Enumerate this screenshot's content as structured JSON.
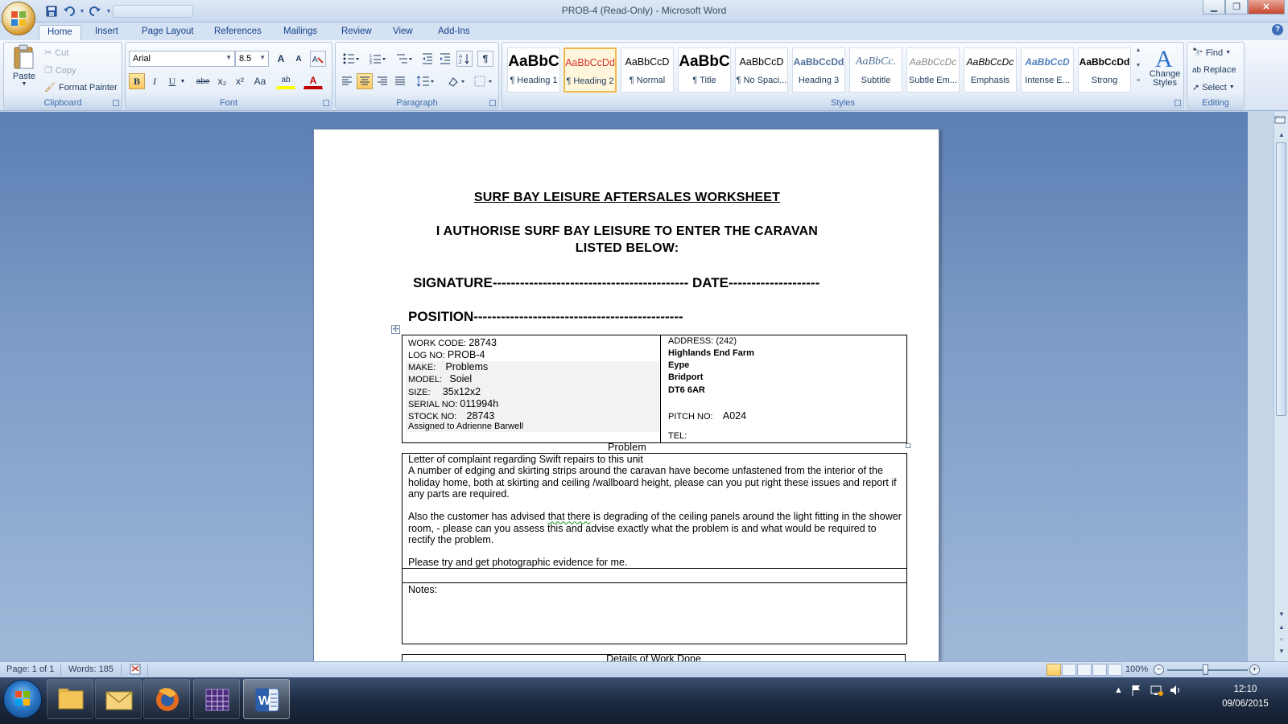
{
  "window": {
    "title": "PROB-4 (Read-Only) - Microsoft Word",
    "min": "▁",
    "max": "❐",
    "close": "✕"
  },
  "tabs": [
    {
      "label": "Home"
    },
    {
      "label": "Insert"
    },
    {
      "label": "Page Layout"
    },
    {
      "label": "References"
    },
    {
      "label": "Mailings"
    },
    {
      "label": "Review"
    },
    {
      "label": "View"
    },
    {
      "label": "Add-Ins"
    }
  ],
  "clipboard": {
    "paste": "Paste",
    "cut": "Cut",
    "copy": "Copy",
    "format_painter": "Format Painter",
    "label": "Clipboard"
  },
  "font": {
    "family": "Arial",
    "size": "8.5",
    "label": "Font",
    "bold": "B",
    "italic": "I",
    "underline": "U",
    "strike": "abe",
    "sub": "x₂",
    "sup": "x²",
    "case": "Aa",
    "grow": "A",
    "shrink": "A",
    "highlight": "ab",
    "color": "A"
  },
  "paragraph": {
    "label": "Paragraph",
    "pilcrow": "¶"
  },
  "styles": {
    "label": "Styles",
    "items": [
      {
        "sample": "AaBbC",
        "name": "¶ Heading 1"
      },
      {
        "sample": "AaBbCcDd",
        "name": "¶ Heading 2"
      },
      {
        "sample": "AaBbCcD",
        "name": "¶ Normal"
      },
      {
        "sample": "AaBbC",
        "name": "¶ Title"
      },
      {
        "sample": "AaBbCcD",
        "name": "¶ No Spaci..."
      },
      {
        "sample": "AaBbCcDd",
        "name": "Heading 3"
      },
      {
        "sample": "AaBbCc.",
        "name": "Subtitle"
      },
      {
        "sample": "AaBbCcDc",
        "name": "Subtle Em..."
      },
      {
        "sample": "AaBbCcDc",
        "name": "Emphasis"
      },
      {
        "sample": "AaBbCcD",
        "name": "Intense E..."
      },
      {
        "sample": "AaBbCcDd",
        "name": "Strong"
      }
    ],
    "change_styles": "Change Styles"
  },
  "editing": {
    "label": "Editing",
    "find": "Find",
    "replace": "Replace",
    "select": "Select"
  },
  "doc": {
    "title": "SURF BAY LEISURE AFTERSALES WORKSHEET",
    "auth1": "I AUTHORISE SURF BAY LEISURE TO ENTER THE CARAVAN",
    "auth2": "LISTED BELOW:",
    "signature": "SIGNATURE------------------------------------------- DATE--------------------",
    "position": "POSITION----------------------------------------------",
    "work_code_label": "WORK CODE:",
    "work_code": "28743",
    "log_no_label": "LOG NO:",
    "log_no": "PROB-4",
    "make_label": "MAKE:",
    "make": "Problems",
    "model_label": "MODEL:",
    "model": "Soiel",
    "size_label": "SIZE:",
    "size": "35x12x2",
    "serial_label": "SERIAL NO:",
    "serial": "011994h",
    "stock_label": "STOCK NO:",
    "stock": "28743",
    "assigned": "Assigned to Adrienne Barwell",
    "address_label": "ADDRESS:",
    "address_num": "(242)",
    "addr1": "Highlands End Farm",
    "addr2": "Eype",
    "addr3": "Bridport",
    "addr4": "DT6 6AR",
    "pitch_label": "PITCH NO:",
    "pitch": "A024",
    "tel_label": "TEL:",
    "problem_header": "Problem",
    "p1": "Letter of complaint regarding Swift repairs to this unit",
    "p2": "A number of edging and skirting strips around the caravan have become unfastened from the interior of the holiday home, both at skirting and ceiling /wallboard height,  please can you put right these issues and report if any parts are required.",
    "p3a": "Also the customer has advised ",
    "p3b": "that there",
    "p3c": " is degrading of the ceiling panels around the light fitting in the shower room, - please can you assess this and advise exactly what the problem is and what would be required to rectify the problem.",
    "p4": "Please try and get photographic evidence for me.",
    "notes": "Notes:",
    "details_header": "Details of Work Done"
  },
  "status": {
    "page": "Page: 1 of 1",
    "words": "Words: 185",
    "zoom": "100%"
  },
  "clock": {
    "time": "12:10",
    "date": "09/06/2015"
  }
}
